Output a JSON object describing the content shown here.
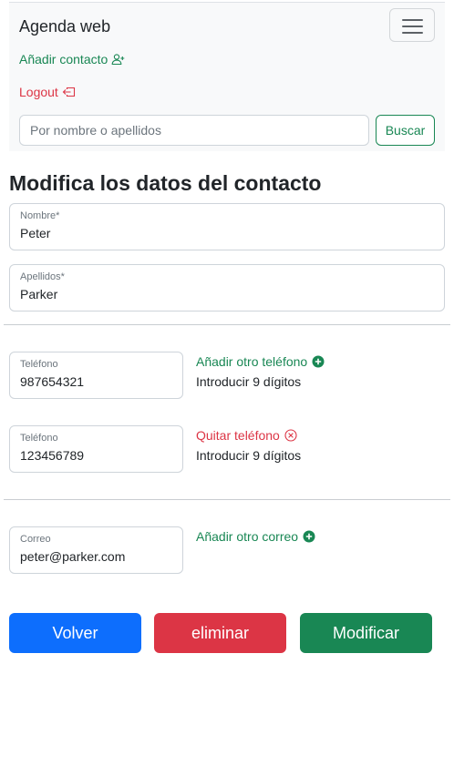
{
  "navbar": {
    "brand": "Agenda web",
    "add_contact_label": "Añadir contacto",
    "logout_label": "Logout",
    "search_placeholder": "Por nombre o apellidos",
    "search_button": "Buscar"
  },
  "page_title": "Modifica los datos del contacto",
  "form": {
    "nombre": {
      "label": "Nombre*",
      "value": "Peter"
    },
    "apellidos": {
      "label": "Apellidos*",
      "value": "Parker"
    },
    "phones": [
      {
        "label": "Teléfono",
        "value": "987654321",
        "action": "Añadir otro teléfono",
        "hint": "Introducir 9 dígitos"
      },
      {
        "label": "Teléfono",
        "value": "123456789",
        "action": "Quitar teléfono",
        "hint": "Introducir 9 dígitos"
      }
    ],
    "email": {
      "label": "Correo",
      "value": "peter@parker.com",
      "action": "Añadir otro correo"
    }
  },
  "buttons": {
    "back": "Volver",
    "delete": "eliminar",
    "modify": "Modificar"
  },
  "colors": {
    "success": "#198754",
    "danger": "#dc3545",
    "primary": "#0d6efd",
    "navbar_bg": "#f8f9fa"
  },
  "icons": {
    "add_contact": "person-plus-icon",
    "logout": "box-arrow-left-icon",
    "menu": "hamburger-menu-icon",
    "add": "plus-circle-fill-icon",
    "remove": "x-circle-icon"
  }
}
